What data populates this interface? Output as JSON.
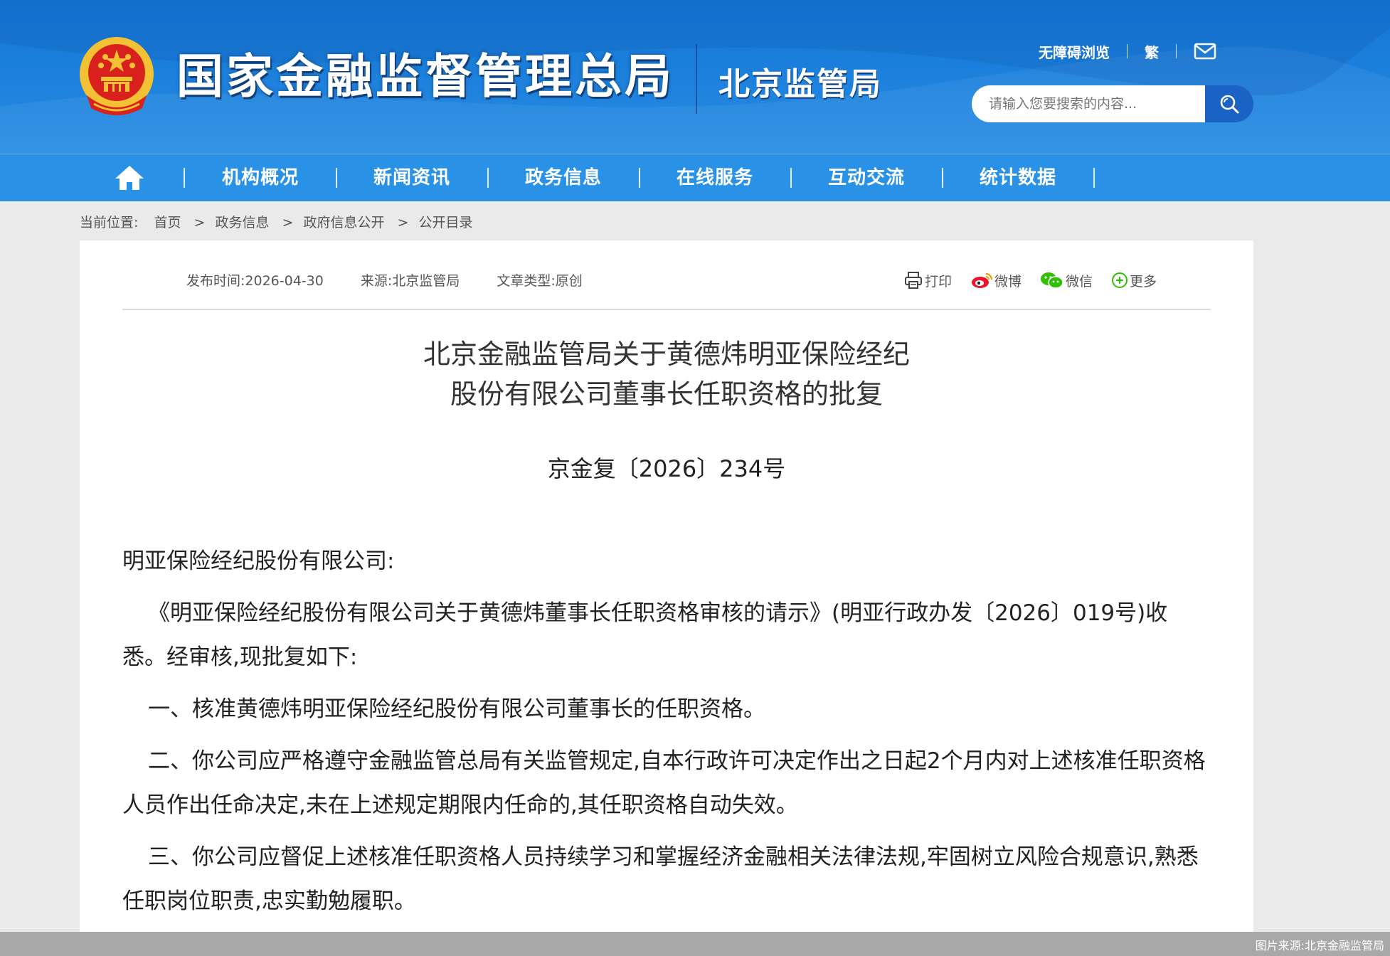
{
  "header": {
    "site_title": "国家金融监督管理总局",
    "sub_title": "北京监管局",
    "top_links": {
      "accessibility": "无障碍浏览",
      "traditional": "繁"
    },
    "search": {
      "placeholder": "请输入您要搜索的内容..."
    }
  },
  "nav": {
    "items": [
      "机构概况",
      "新闻资讯",
      "政务信息",
      "在线服务",
      "互动交流",
      "统计数据"
    ]
  },
  "breadcrumb": {
    "lead": "当前位置:",
    "items": [
      "首页",
      "政务信息",
      "政府信息公开",
      "公开目录"
    ]
  },
  "meta": {
    "publish_time": "发布时间:2026-04-30",
    "source": "来源:北京监管局",
    "article_type": "文章类型:原创"
  },
  "share": {
    "print": "打印",
    "weibo": "微博",
    "wechat": "微信",
    "more": "更多"
  },
  "document": {
    "title_line1": "北京金融监管局关于黄德炜明亚保险经纪",
    "title_line2": "股份有限公司董事长任职资格的批复",
    "number": "京金复〔2026〕234号",
    "salutation": "明亚保险经纪股份有限公司:",
    "paragraphs": [
      "《明亚保险经纪股份有限公司关于黄德炜董事长任职资格审核的请示》(明亚行政办发〔2026〕019号)收悉。经审核,现批复如下:",
      "一、核准黄德炜明亚保险经纪股份有限公司董事长的任职资格。",
      "二、你公司应严格遵守金融监管总局有关监管规定,自本行政许可决定作出之日起2个月内对上述核准任职资格人员作出任命决定,未在上述规定期限内任命的,其任职资格自动失效。",
      "三、你公司应督促上述核准任职资格人员持续学习和掌握经济金融相关法律法规,牢固树立风险合规意识,熟悉任职岗位职责,忠实勤勉履职。"
    ]
  },
  "footer": {
    "credit": "图片来源:北京金融监管局"
  },
  "colors": {
    "header_blue": "#1b7fdc",
    "nav_blue": "#2a92e6",
    "search_button": "#1a63c4",
    "emblem_red": "#d8201c",
    "emblem_gold": "#f3c234"
  }
}
